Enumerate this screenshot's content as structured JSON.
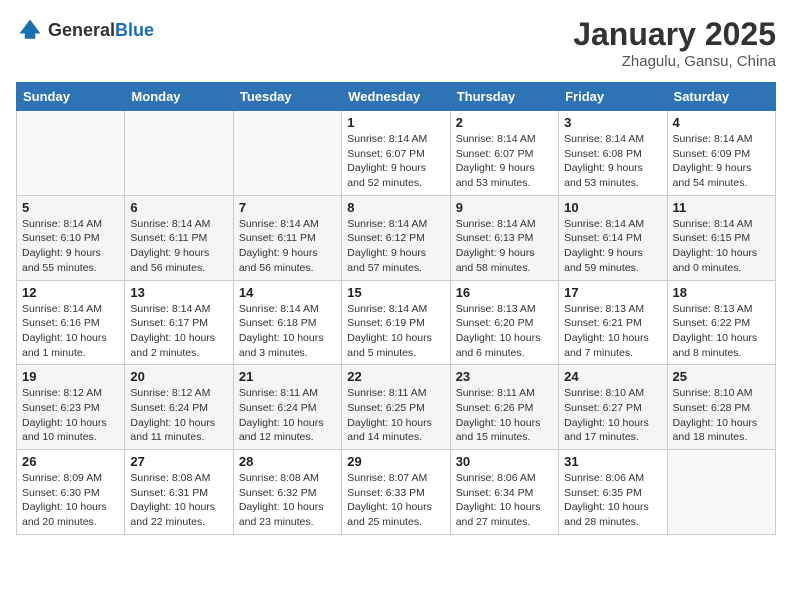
{
  "header": {
    "logo_general": "General",
    "logo_blue": "Blue",
    "month_year": "January 2025",
    "location": "Zhagulu, Gansu, China"
  },
  "days_of_week": [
    "Sunday",
    "Monday",
    "Tuesday",
    "Wednesday",
    "Thursday",
    "Friday",
    "Saturday"
  ],
  "weeks": [
    [
      {
        "day": "",
        "info": ""
      },
      {
        "day": "",
        "info": ""
      },
      {
        "day": "",
        "info": ""
      },
      {
        "day": "1",
        "info": "Sunrise: 8:14 AM\nSunset: 6:07 PM\nDaylight: 9 hours and 52 minutes."
      },
      {
        "day": "2",
        "info": "Sunrise: 8:14 AM\nSunset: 6:07 PM\nDaylight: 9 hours and 53 minutes."
      },
      {
        "day": "3",
        "info": "Sunrise: 8:14 AM\nSunset: 6:08 PM\nDaylight: 9 hours and 53 minutes."
      },
      {
        "day": "4",
        "info": "Sunrise: 8:14 AM\nSunset: 6:09 PM\nDaylight: 9 hours and 54 minutes."
      }
    ],
    [
      {
        "day": "5",
        "info": "Sunrise: 8:14 AM\nSunset: 6:10 PM\nDaylight: 9 hours and 55 minutes."
      },
      {
        "day": "6",
        "info": "Sunrise: 8:14 AM\nSunset: 6:11 PM\nDaylight: 9 hours and 56 minutes."
      },
      {
        "day": "7",
        "info": "Sunrise: 8:14 AM\nSunset: 6:11 PM\nDaylight: 9 hours and 56 minutes."
      },
      {
        "day": "8",
        "info": "Sunrise: 8:14 AM\nSunset: 6:12 PM\nDaylight: 9 hours and 57 minutes."
      },
      {
        "day": "9",
        "info": "Sunrise: 8:14 AM\nSunset: 6:13 PM\nDaylight: 9 hours and 58 minutes."
      },
      {
        "day": "10",
        "info": "Sunrise: 8:14 AM\nSunset: 6:14 PM\nDaylight: 9 hours and 59 minutes."
      },
      {
        "day": "11",
        "info": "Sunrise: 8:14 AM\nSunset: 6:15 PM\nDaylight: 10 hours and 0 minutes."
      }
    ],
    [
      {
        "day": "12",
        "info": "Sunrise: 8:14 AM\nSunset: 6:16 PM\nDaylight: 10 hours and 1 minute."
      },
      {
        "day": "13",
        "info": "Sunrise: 8:14 AM\nSunset: 6:17 PM\nDaylight: 10 hours and 2 minutes."
      },
      {
        "day": "14",
        "info": "Sunrise: 8:14 AM\nSunset: 6:18 PM\nDaylight: 10 hours and 3 minutes."
      },
      {
        "day": "15",
        "info": "Sunrise: 8:14 AM\nSunset: 6:19 PM\nDaylight: 10 hours and 5 minutes."
      },
      {
        "day": "16",
        "info": "Sunrise: 8:13 AM\nSunset: 6:20 PM\nDaylight: 10 hours and 6 minutes."
      },
      {
        "day": "17",
        "info": "Sunrise: 8:13 AM\nSunset: 6:21 PM\nDaylight: 10 hours and 7 minutes."
      },
      {
        "day": "18",
        "info": "Sunrise: 8:13 AM\nSunset: 6:22 PM\nDaylight: 10 hours and 8 minutes."
      }
    ],
    [
      {
        "day": "19",
        "info": "Sunrise: 8:12 AM\nSunset: 6:23 PM\nDaylight: 10 hours and 10 minutes."
      },
      {
        "day": "20",
        "info": "Sunrise: 8:12 AM\nSunset: 6:24 PM\nDaylight: 10 hours and 11 minutes."
      },
      {
        "day": "21",
        "info": "Sunrise: 8:11 AM\nSunset: 6:24 PM\nDaylight: 10 hours and 12 minutes."
      },
      {
        "day": "22",
        "info": "Sunrise: 8:11 AM\nSunset: 6:25 PM\nDaylight: 10 hours and 14 minutes."
      },
      {
        "day": "23",
        "info": "Sunrise: 8:11 AM\nSunset: 6:26 PM\nDaylight: 10 hours and 15 minutes."
      },
      {
        "day": "24",
        "info": "Sunrise: 8:10 AM\nSunset: 6:27 PM\nDaylight: 10 hours and 17 minutes."
      },
      {
        "day": "25",
        "info": "Sunrise: 8:10 AM\nSunset: 6:28 PM\nDaylight: 10 hours and 18 minutes."
      }
    ],
    [
      {
        "day": "26",
        "info": "Sunrise: 8:09 AM\nSunset: 6:30 PM\nDaylight: 10 hours and 20 minutes."
      },
      {
        "day": "27",
        "info": "Sunrise: 8:08 AM\nSunset: 6:31 PM\nDaylight: 10 hours and 22 minutes."
      },
      {
        "day": "28",
        "info": "Sunrise: 8:08 AM\nSunset: 6:32 PM\nDaylight: 10 hours and 23 minutes."
      },
      {
        "day": "29",
        "info": "Sunrise: 8:07 AM\nSunset: 6:33 PM\nDaylight: 10 hours and 25 minutes."
      },
      {
        "day": "30",
        "info": "Sunrise: 8:06 AM\nSunset: 6:34 PM\nDaylight: 10 hours and 27 minutes."
      },
      {
        "day": "31",
        "info": "Sunrise: 8:06 AM\nSunset: 6:35 PM\nDaylight: 10 hours and 28 minutes."
      },
      {
        "day": "",
        "info": ""
      }
    ]
  ]
}
